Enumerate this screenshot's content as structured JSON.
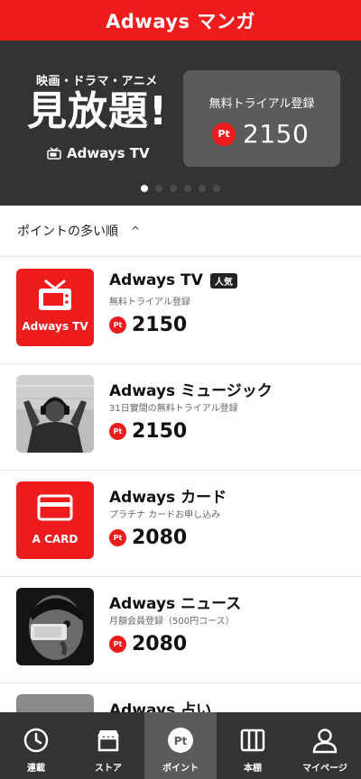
{
  "app": {
    "title": "Adways マンガ"
  },
  "hero": {
    "subtitle": "映画・ドラマ・アニメ",
    "headline": "見放題!",
    "service": "Adways TV",
    "cta_label": "無料トライアル登録",
    "points_badge": "Pt",
    "points": "2150",
    "slides_total": 6,
    "slide_active": 1
  },
  "sort": {
    "label": "ポイントの多い順",
    "caret": "^"
  },
  "items": [
    {
      "name": "Adways TV",
      "tag": "人気",
      "desc": "無料トライアル登録",
      "badge": "Pt",
      "points": "2150",
      "thumb_label": "Adways TV"
    },
    {
      "name": "Adways ミュージック",
      "desc": "31日實間の無料トライアル登録",
      "badge": "Pt",
      "points": "2150"
    },
    {
      "name": "Adways カード",
      "desc": "プラチナ カードお申し込み",
      "badge": "Pt",
      "points": "2080",
      "thumb_label": "A CARD"
    },
    {
      "name": "Adways ニュース",
      "desc": "月額会員登録（500円コース）",
      "badge": "Pt",
      "points": "2080"
    },
    {
      "name": "Adways 占い"
    }
  ],
  "tabs": [
    {
      "label": "連載",
      "icon": "clock-icon"
    },
    {
      "label": "ストア",
      "icon": "store-icon"
    },
    {
      "label": "ポイント",
      "icon": "points-icon",
      "icon_text": "Pt",
      "active": true
    },
    {
      "label": "本棚",
      "icon": "bookshelf-icon"
    },
    {
      "label": "マイページ",
      "icon": "user-icon"
    }
  ],
  "colors": {
    "brand_red": "#ee1c1c",
    "dark": "#333333",
    "card_gray": "#5b5b5b"
  }
}
